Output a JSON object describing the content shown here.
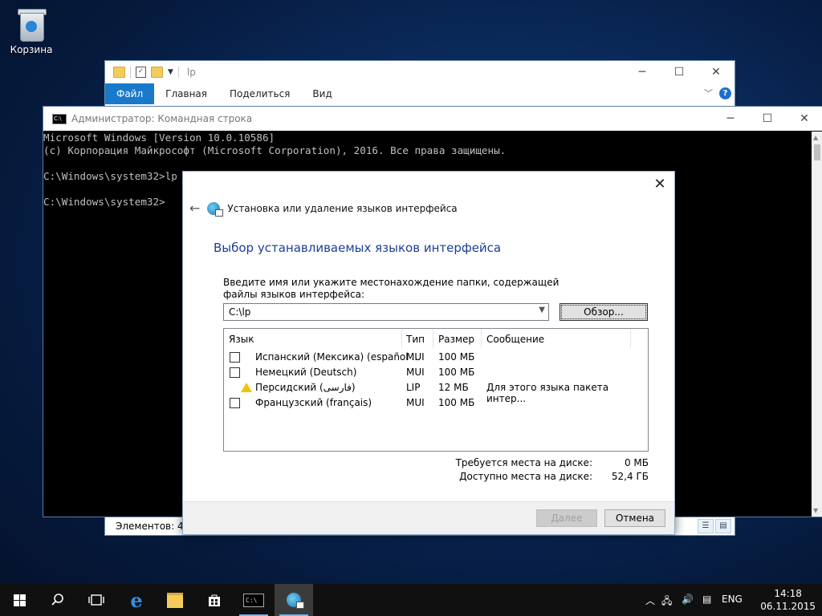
{
  "desktop": {
    "recycle_bin_label": "Корзина"
  },
  "explorer": {
    "title": "lp",
    "tabs": [
      "Файл",
      "Главная",
      "Поделиться",
      "Вид"
    ],
    "status": "Элементов: 4"
  },
  "cmd": {
    "title": "Администратор: Командная строка",
    "lines": [
      "Microsoft Windows [Version 10.0.10586]",
      "(c) Корпорация Майкрософт (Microsoft Corporation), 2016. Все права защищены.",
      "",
      "C:\\Windows\\system32>lp",
      "",
      "C:\\Windows\\system32>"
    ]
  },
  "dialog": {
    "nav_title": "Установка или удаление языков интерфейса",
    "heading": "Выбор устанавливаемых языков интерфейса",
    "prompt": "Введите имя или укажите местонахождение папки, содержащей файлы языков интерфейса:",
    "path_value": "C:\\lp",
    "browse_label": "Обзор...",
    "columns": {
      "language": "Язык",
      "type": "Тип",
      "size": "Размер",
      "message": "Сообщение"
    },
    "rows": [
      {
        "language": "Испанский (Мексика) (español ...",
        "type": "MUI",
        "size": "100 МБ",
        "message": "",
        "checked": false,
        "warning": false
      },
      {
        "language": "Немецкий (Deutsch)",
        "type": "MUI",
        "size": "100 МБ",
        "message": "",
        "checked": false,
        "warning": false
      },
      {
        "language": "Персидский (فارسی)",
        "type": "LIP",
        "size": "12 МБ",
        "message": "Для этого языка пакета интер...",
        "checked": false,
        "warning": true
      },
      {
        "language": "Французский (français)",
        "type": "MUI",
        "size": "100 МБ",
        "message": "",
        "checked": false,
        "warning": false
      }
    ],
    "space_required_label": "Требуется места на диске:",
    "space_required_value": "0 МБ",
    "space_available_label": "Доступно места на диске:",
    "space_available_value": "52,4 ГБ",
    "next_label": "Далее",
    "cancel_label": "Отмена"
  },
  "taskbar": {
    "language": "ENG",
    "time": "14:18",
    "date": "06.11.2015"
  }
}
